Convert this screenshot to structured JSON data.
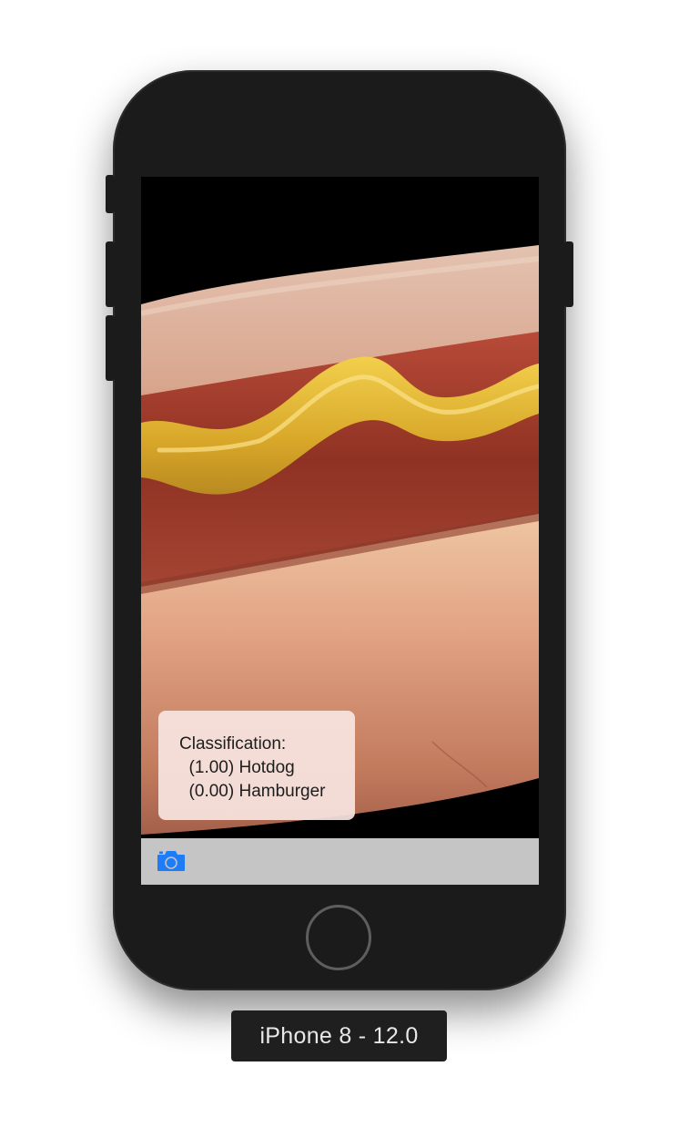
{
  "device_label": "iPhone 8 - 12.0",
  "status_bar": {
    "battery_color": "#4cd964"
  },
  "result": {
    "heading": "Classification:",
    "items": [
      {
        "text": "  (1.00) Hotdog"
      },
      {
        "text": "  (0.00) Hamburger"
      }
    ]
  },
  "toolbar": {
    "camera_icon": "camera-icon",
    "accent_color": "#1f7cf7"
  }
}
